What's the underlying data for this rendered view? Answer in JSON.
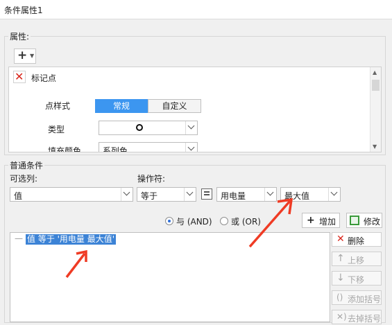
{
  "window": {
    "title": "条件属性1"
  },
  "properties": {
    "legend": "属性:",
    "add_icon": "plus-icon",
    "marker": {
      "delete_icon": "red-x-icon",
      "title": "标记点",
      "point_style": {
        "label": "点样式",
        "tabs": [
          "常规",
          "自定义"
        ],
        "active": 0
      },
      "type": {
        "label": "类型",
        "value": "○",
        "icon": "hollow-circle"
      },
      "fill_color": {
        "label": "填充颜色",
        "value": "系列色"
      }
    }
  },
  "condition": {
    "legend": "普通条件",
    "column_label": "可选列:",
    "operator_label": "操作符:",
    "column_value": "值",
    "operator_value": "等于",
    "param_icon": "formula-icon",
    "field_value": "用电量",
    "agg_value": "最大值",
    "radio_and": "与 (AND)",
    "radio_or": "或 (OR)",
    "radio_selected": "and",
    "add_button": "增加",
    "edit_button": "修改",
    "list_prefix": "—",
    "list_item": "值 等于 '用电量 最大值'",
    "side_buttons": [
      {
        "label": "删除",
        "icon": "red-x-icon",
        "enabled": true
      },
      {
        "label": "上移",
        "icon": "arrow-up-icon",
        "enabled": false
      },
      {
        "label": "下移",
        "icon": "arrow-down-icon",
        "enabled": false
      },
      {
        "label": "添加括号",
        "icon": "parentheses-icon",
        "enabled": false
      },
      {
        "label": "去掉括号",
        "icon": "remove-parentheses-icon",
        "enabled": false
      }
    ]
  },
  "colors": {
    "accent": "#3c96f0",
    "selection": "#3c83d6",
    "annotation_arrow": "#ef3b24",
    "delete_red": "#d9261c"
  }
}
